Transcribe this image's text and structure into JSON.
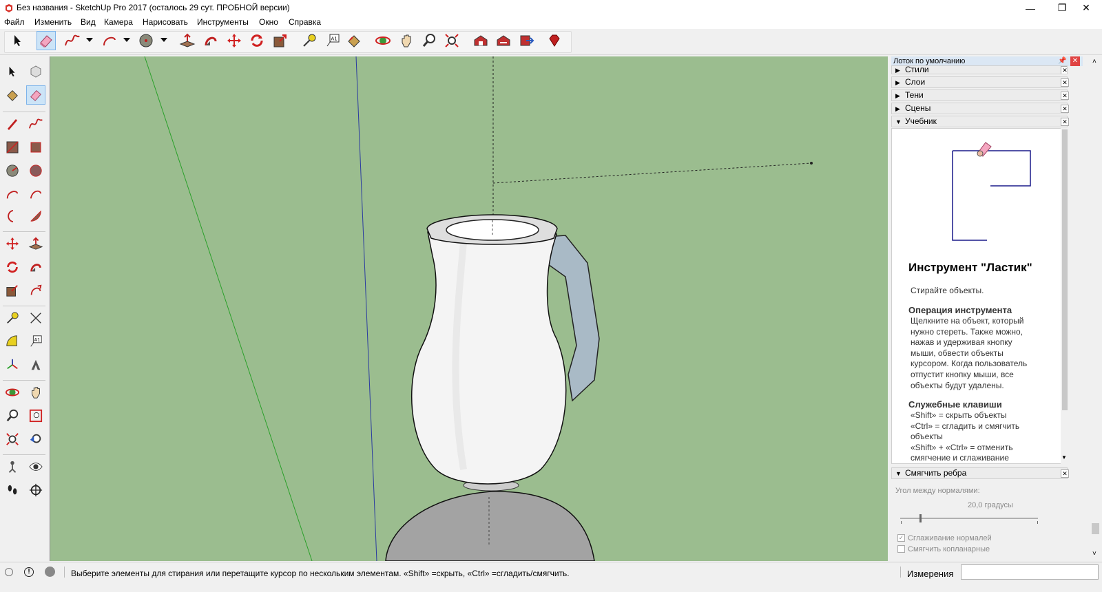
{
  "window": {
    "title": "Без названия - SketchUp Pro 2017 (осталось 29 сут. ПРОБНОЙ версии)",
    "minimize": "—",
    "maximize": "❐",
    "close": "✕"
  },
  "menu": [
    {
      "label": "Файл",
      "icon": ""
    },
    {
      "label": "Изменить"
    },
    {
      "label": "Вид"
    },
    {
      "label": "Камера"
    },
    {
      "label": "Нарисовать"
    },
    {
      "label": "Инструменты"
    },
    {
      "label": "Окно"
    },
    {
      "label": "Справка"
    }
  ],
  "toolbar": {
    "buttons": [
      "select-icon",
      "eraser-icon",
      "freehand-icon",
      "arc-icon",
      "circle-icon",
      "push-pull-icon",
      "follow-me-icon",
      "move-icon",
      "rotate-icon",
      "scale-icon",
      "tape-measure-icon",
      "text-icon",
      "paint-bucket-icon",
      "orbit-icon",
      "pan-icon",
      "zoom-icon",
      "zoom-extents-icon",
      "warehouse-icon",
      "extension-warehouse-icon",
      "share-model-icon",
      "ruby-icon"
    ],
    "active": "eraser-icon"
  },
  "tray": {
    "title": "Лоток по умолчанию",
    "panels": [
      {
        "label": "Стили",
        "expanded": false
      },
      {
        "label": "Слои",
        "expanded": false
      },
      {
        "label": "Тени",
        "expanded": false
      },
      {
        "label": "Сцены",
        "expanded": false
      },
      {
        "label": "Учебник",
        "expanded": true
      }
    ],
    "instructor": {
      "title": "Инструмент \"Ластик\"",
      "subtitle": "Стирайте объекты.",
      "operation_heading": "Операция инструмента",
      "operation_lines": [
        "Щелкните на объект, который",
        "нужно стереть. Также можно,",
        "нажав и удерживая кнопку",
        "мыши, обвести объекты",
        "курсором. Когда пользователь",
        "отпустит кнопку мыши, все",
        "объекты будут удалены."
      ],
      "keys_heading": "Служебные клавиши",
      "keys_lines": [
        "«Shift» = скрыть объекты",
        "«Ctrl» = сгладить и смягчить",
        "объекты",
        "«Shift» + «Ctrl» = отменить",
        "смягчение и сглаживание"
      ]
    },
    "smooth": {
      "label": "Смягчить ребра",
      "angle_label": "Угол между нормалями:",
      "angle_value": "20,0  градусы",
      "slider_fraction": 0.14,
      "opt_smooth_normals": "Сглаживание нормалей",
      "opt_soften_coplanar": "Смягчить копланарные",
      "smooth_normals_checked": true,
      "soften_coplanar_checked": false
    }
  },
  "status": {
    "text": "Выберите элементы для стирания или перетащите курсор по нескольким элементам. «Shift» =скрыть, «Ctrl» =сгладить/смягчить.",
    "measurements_label": "Измерения",
    "measurements_value": ""
  },
  "colors": {
    "viewport_bg": "#9bbd8f",
    "accent_selected": "#cce4f7",
    "axis_green": "#2aa02a",
    "axis_blue": "#2a3aa0"
  }
}
